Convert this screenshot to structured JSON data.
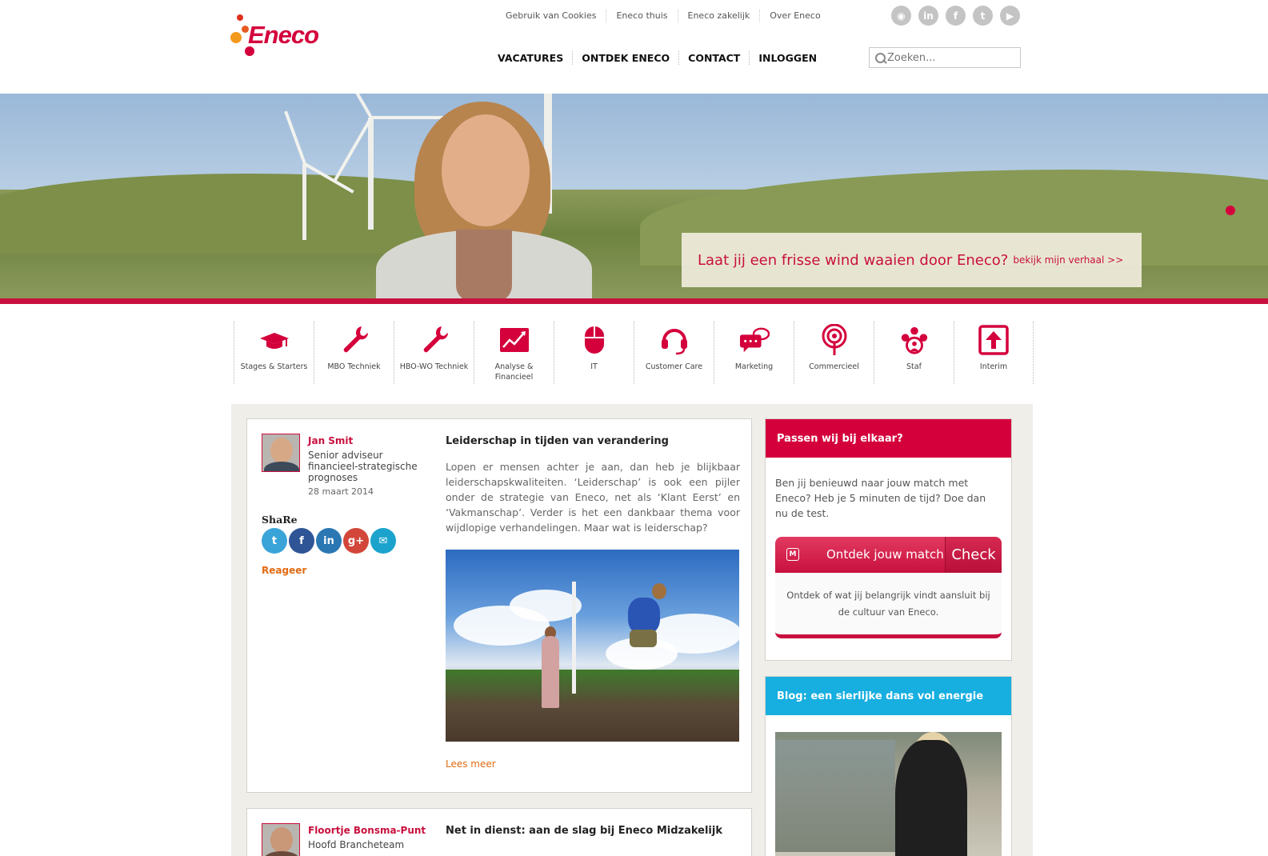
{
  "brand": {
    "name": "Eneco",
    "color": "#d4003c",
    "accent_orange": "#e26a12"
  },
  "top_links": [
    "Gebruik van Cookies",
    "Eneco thuis",
    "Eneco zakelijk",
    "Over Eneco"
  ],
  "main_nav": [
    "VACATURES",
    "ONTDEK ENECO",
    "CONTACT",
    "INLOGGEN"
  ],
  "social": [
    {
      "name": "rss-icon",
      "glyph": "◉"
    },
    {
      "name": "linkedin-icon",
      "glyph": "in"
    },
    {
      "name": "facebook-icon",
      "glyph": "f"
    },
    {
      "name": "twitter-icon",
      "glyph": "t"
    },
    {
      "name": "youtube-icon",
      "glyph": "▶"
    }
  ],
  "search": {
    "placeholder": "Zoeken..."
  },
  "hero": {
    "headline": "Laat jij een frisse wind waaien door Eneco?",
    "link": "bekijk mijn verhaal >>"
  },
  "categories": [
    {
      "label": "Stages & Starters",
      "icon": "graduation-cap-icon"
    },
    {
      "label": "MBO Techniek",
      "icon": "wrench-icon"
    },
    {
      "label": "HBO-WO Techniek",
      "icon": "wrench-icon"
    },
    {
      "label": "Analyse & Financieel",
      "icon": "chart-icon"
    },
    {
      "label": "IT",
      "icon": "mouse-icon"
    },
    {
      "label": "Customer Care",
      "icon": "headset-icon"
    },
    {
      "label": "Marketing",
      "icon": "chat-icon"
    },
    {
      "label": "Commercieel",
      "icon": "target-icon"
    },
    {
      "label": "Staf",
      "icon": "team-icon"
    },
    {
      "label": "Interim",
      "icon": "upload-icon"
    }
  ],
  "posts": [
    {
      "author": "Jan Smit",
      "role": "Senior adviseur financieel-strategische prognoses",
      "date": "28 maart 2014",
      "share_label": "ShaRe",
      "comment_label": "Reageer",
      "title": "Leiderschap in tijden van verandering",
      "excerpt": "Lopen er mensen achter je aan, dan heb je blijkbaar leiderschapskwaliteiten. ‘Leiderschap’ is ook een pijler onder de strategie van Eneco, net als ‘Klant Eerst’ en ‘Vakmanschap’. Verder is het een dankbaar thema voor wijdlopige verhandelingen. Maar wat is leiderschap?",
      "read_more": "Lees meer"
    },
    {
      "author": "Floortje Bonsma-Punt",
      "role": "Hoofd Brancheteam",
      "title": "Net in dienst: aan de slag bij Eneco Midzakelijk"
    }
  ],
  "share_buttons": [
    {
      "name": "twitter-share-icon",
      "glyph": "t",
      "color": "#3aa4d9"
    },
    {
      "name": "facebook-share-icon",
      "glyph": "f",
      "color": "#2f5596"
    },
    {
      "name": "linkedin-share-icon",
      "glyph": "in",
      "color": "#2a77b3"
    },
    {
      "name": "googleplus-share-icon",
      "glyph": "g+",
      "color": "#d2473a"
    },
    {
      "name": "email-share-icon",
      "glyph": "✉",
      "color": "#1ba3cd"
    }
  ],
  "sidebar": {
    "match": {
      "title": "Passen wij bij elkaar?",
      "text": "Ben jij benieuwd naar jouw match met Eneco? Heb je 5 minuten de tijd? Doe dan nu de test.",
      "logo": "M",
      "button_label": "Ontdek jouw match",
      "check_label": "Check",
      "description": "Ontdek of wat jij belangrijk vindt aansluit bij de cultuur van Eneco.",
      "header_color": "#d4003c"
    },
    "blog": {
      "title": "Blog: een sierlijke dans vol energie",
      "header_color": "#17aee0"
    }
  }
}
